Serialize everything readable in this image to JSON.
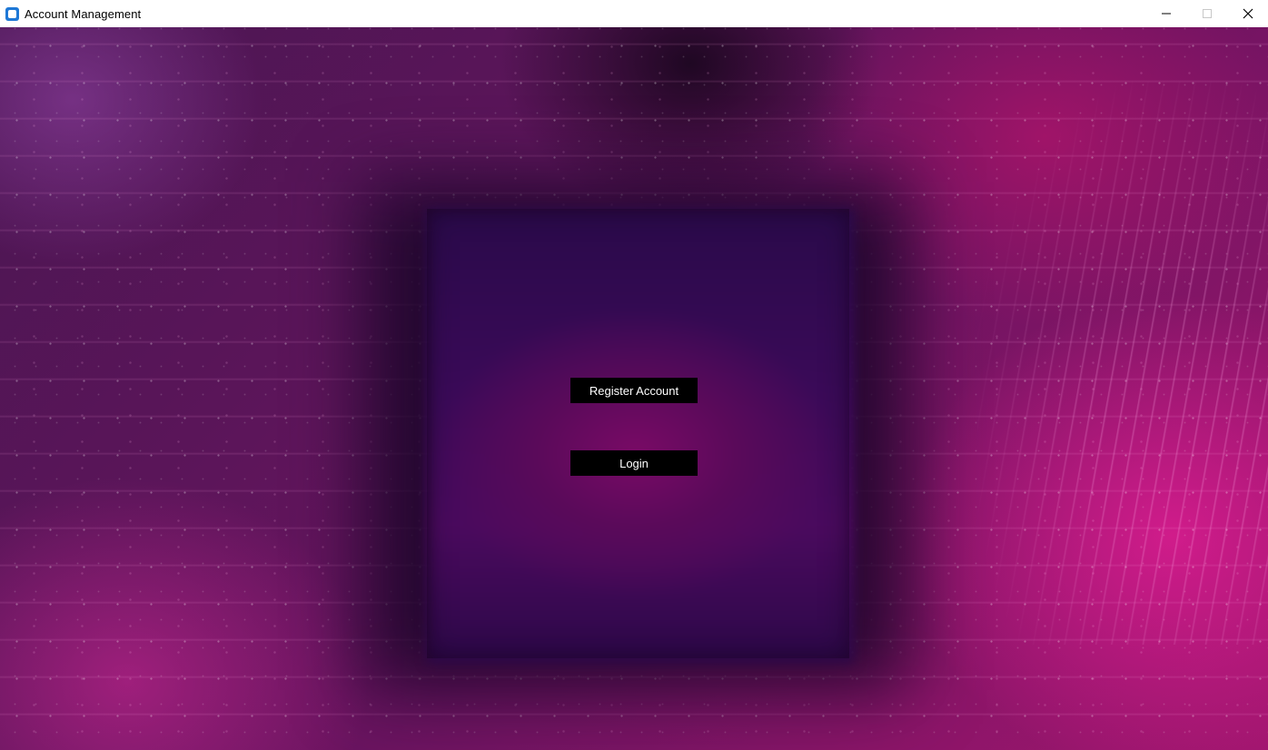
{
  "window": {
    "title": "Account Management",
    "icon": "app-window-icon",
    "controls": {
      "minimize_icon": "minimize-icon",
      "maximize_icon": "maximize-icon",
      "close_icon": "close-icon"
    }
  },
  "main": {
    "background": "abstract-purple-magenta-artwork",
    "buttons": {
      "register_label": "Register Account",
      "login_label": "Login"
    }
  },
  "colors": {
    "button_bg": "#000000",
    "button_text": "#ffffff",
    "titlebar_bg": "#ffffff",
    "accent_magenta": "#a0166e",
    "panel_purple": "#3a0a58"
  }
}
